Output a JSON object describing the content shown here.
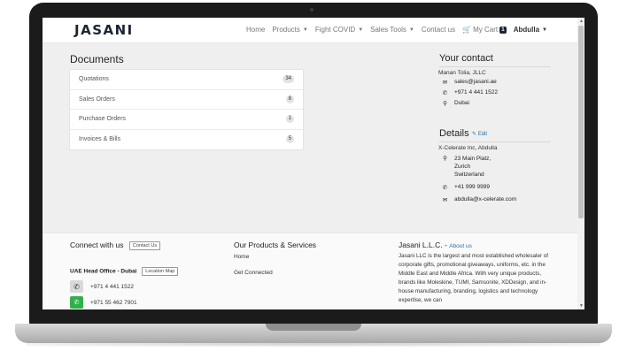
{
  "navbar": {
    "logo": "JASANI",
    "items": [
      {
        "label": "Home",
        "caret": false
      },
      {
        "label": "Products",
        "caret": true
      },
      {
        "label": "Fight COVID",
        "caret": true
      },
      {
        "label": "Sales Tools",
        "caret": true
      },
      {
        "label": "Contact us",
        "caret": false
      }
    ],
    "cart_label": "My Cart",
    "cart_count": "1",
    "user": "Abdulla"
  },
  "documents": {
    "title": "Documents",
    "rows": [
      {
        "label": "Quotations",
        "count": "34"
      },
      {
        "label": "Sales Orders",
        "count": "8"
      },
      {
        "label": "Purchase Orders",
        "count": "1"
      },
      {
        "label": "Invoices & Bills",
        "count": "5"
      }
    ]
  },
  "contact": {
    "title": "Your contact",
    "company": "Manan Tolia, JLLC",
    "email": "sales@jasani.ae",
    "phone": "+971 4 441 1522",
    "city": "Dubai"
  },
  "details": {
    "title": "Details",
    "edit_label": "Edit",
    "company": "X-Celerate Inc, Abdulla",
    "address_line1": "23 Main Platz,",
    "address_line2": "Zurich",
    "address_line3": "Switzerland",
    "phone": "+41 999 9999",
    "email": "abdulla@x-celerate.com"
  },
  "footer": {
    "connect_title": "Connect with us",
    "contact_us_btn": "Contact Us",
    "office_label": "UAE Head Office - Dubai",
    "location_btn": "Location Map",
    "phone": "+971 4 441 1522",
    "whatsapp": "+971 55 462 7901",
    "products_title": "Our Products & Services",
    "products_links": [
      "Home",
      "Get Connected"
    ],
    "about_title": "Jasani L.L.C.",
    "about_link": "About us",
    "about_text": "Jasani LLC is the largest and most established wholesaler of corporate gifts, promotional giveaways, uniforms, etc. in the Middle East and Middle Africa. With very unique products, brands like Moleskine, TUMI, Samsonite, XDDesign, and in-house manufacturing, branding, logistics and technology expertise, we can"
  }
}
